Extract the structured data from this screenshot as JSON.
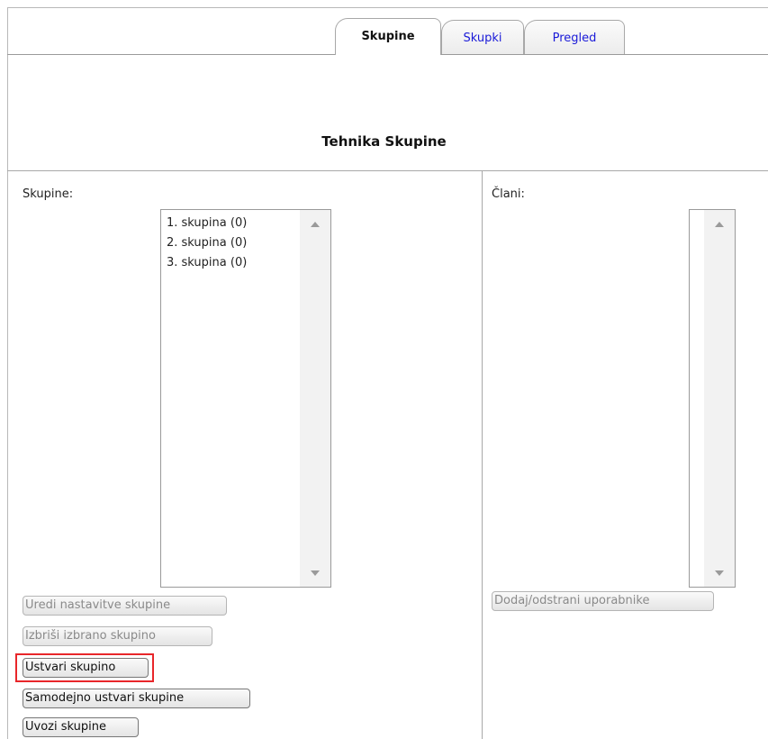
{
  "tabs": [
    {
      "label": "Skupine",
      "active": true
    },
    {
      "label": "Skupki",
      "active": false
    },
    {
      "label": "Pregled",
      "active": false
    }
  ],
  "heading": "Tehnika Skupine",
  "groups": {
    "label": "Skupine:",
    "items": [
      "1. skupina (0)",
      "2. skupina (0)",
      "3. skupina (0)"
    ]
  },
  "members": {
    "label": "Člani:",
    "items": []
  },
  "buttons": {
    "edit_group": "Uredi nastavitve skupine",
    "delete_group": "Izbriši izbrano skupino",
    "create_group": "Ustvari skupino",
    "auto_create": "Samodejno ustvari skupine",
    "import_groups": "Uvozi skupine",
    "manage_members": "Dodaj/odstrani uporabnike"
  },
  "colors": {
    "link_tab": "#1a1ad8",
    "highlight": "#e8262a",
    "disabled_text": "#8a8a8a"
  }
}
